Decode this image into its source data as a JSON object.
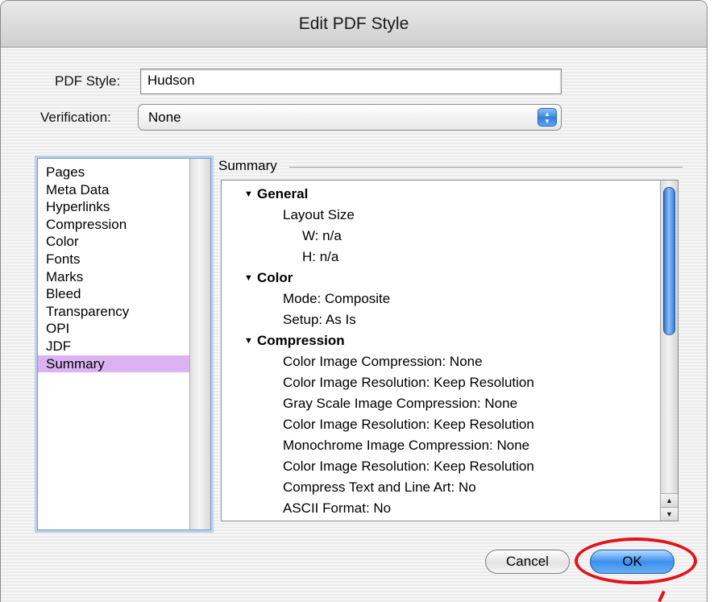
{
  "window": {
    "title": "Edit PDF Style"
  },
  "form": {
    "style_label": "PDF Style:",
    "style_value": "Hudson",
    "verification_label": "Verification:",
    "verification_value": "None"
  },
  "sidebar": {
    "items": [
      {
        "label": "Pages"
      },
      {
        "label": "Meta Data"
      },
      {
        "label": "Hyperlinks"
      },
      {
        "label": "Compression"
      },
      {
        "label": "Color"
      },
      {
        "label": "Fonts"
      },
      {
        "label": "Marks"
      },
      {
        "label": "Bleed"
      },
      {
        "label": "Transparency"
      },
      {
        "label": "OPI"
      },
      {
        "label": "JDF"
      },
      {
        "label": "Summary"
      }
    ],
    "selected": "Summary"
  },
  "summary": {
    "group_label": "Summary",
    "rows": [
      {
        "text": "General",
        "level": "section"
      },
      {
        "text": "Layout Size",
        "level": "l1"
      },
      {
        "text": "W: n/a",
        "level": "l2"
      },
      {
        "text": "H: n/a",
        "level": "l2"
      },
      {
        "text": "Color",
        "level": "section"
      },
      {
        "text": "Mode: Composite",
        "level": "l1"
      },
      {
        "text": "Setup: As Is",
        "level": "l1"
      },
      {
        "text": "Compression",
        "level": "section"
      },
      {
        "text": "Color Image Compression: None",
        "level": "l1"
      },
      {
        "text": "Color Image Resolution: Keep Resolution",
        "level": "l1"
      },
      {
        "text": "Gray Scale Image Compression: None",
        "level": "l1"
      },
      {
        "text": "Color Image Resolution: Keep Resolution",
        "level": "l1"
      },
      {
        "text": "Monochrome Image Compression: None",
        "level": "l1"
      },
      {
        "text": "Color Image Resolution: Keep Resolution",
        "level": "l1"
      },
      {
        "text": "Compress Text and Line Art: No",
        "level": "l1"
      },
      {
        "text": "ASCII Format: No",
        "level": "l1"
      }
    ]
  },
  "buttons": {
    "cancel_label": "Cancel",
    "ok_label": "OK"
  },
  "icons": {
    "disclosure": "disclosure-triangle-down-icon",
    "popup": "popup-arrows-icon",
    "scroll_up": "scroll-up-arrow-icon",
    "scroll_down": "scroll-down-arrow-icon"
  },
  "colors": {
    "selection": "#dcb3f2",
    "accent": "#3c8ff0",
    "annotation": "#e0141c"
  }
}
